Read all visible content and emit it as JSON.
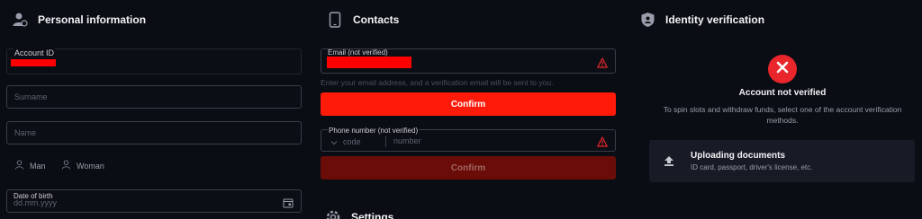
{
  "personal": {
    "title": "Personal information",
    "account_id_label": "Account ID",
    "surname_placeholder": "Surname",
    "name_placeholder": "Name",
    "gender_man": "Man",
    "gender_woman": "Woman",
    "dob_label": "Date of birth",
    "dob_placeholder": "dd.mm.yyyy"
  },
  "contacts": {
    "title": "Contacts",
    "email_label": "Email (not verified)",
    "email_hint": "Enter your email address, and a verification email will be sent to you.",
    "confirm_email": "Confirm",
    "phone_label": "Phone number (not verified)",
    "code_placeholder": "code",
    "number_placeholder": "number",
    "confirm_phone": "Confirm"
  },
  "settings": {
    "title": "Settings"
  },
  "identity": {
    "title": "Identity verification",
    "status": "Account not verified",
    "description": "To spin slots and withdraw funds, select one of the account verification methods.",
    "upload_title": "Uploading documents",
    "upload_subtitle": "ID card, passport, driver's license, etc."
  },
  "colors": {
    "accent": "#ff1a0a",
    "background": "#0b0d14",
    "error": "#e8262b"
  },
  "icons": [
    "user-id-icon",
    "phone-icon",
    "shield-user-icon",
    "warning-icon",
    "person-icon",
    "calendar-icon",
    "chevron-down-icon",
    "close-icon",
    "upload-icon",
    "gear-icon"
  ]
}
